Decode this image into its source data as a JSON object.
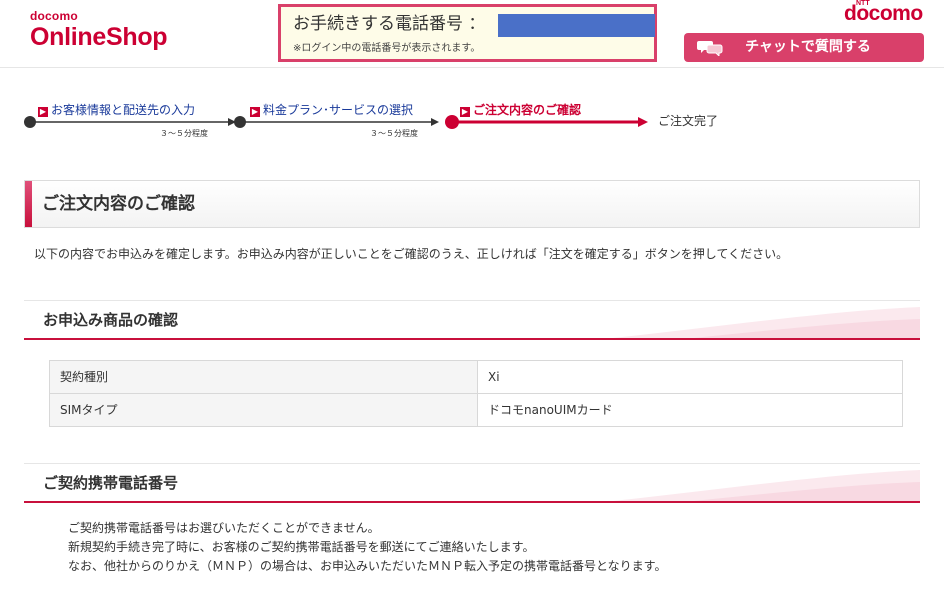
{
  "header": {
    "logo_small": "docomo",
    "logo_big": "OnlineShop",
    "phone_label": "お手続きする電話番号 ：",
    "phone_note": "※ログイン中の電話番号が表示されます。",
    "brand_ntt": "NTT",
    "brand_name": "docomo",
    "chat_button": "チャットで質問する",
    "chat_icon": "chat-bubbles-icon"
  },
  "steps": [
    {
      "label": "お客様情報と配送先の入力",
      "time": "３〜５分程度",
      "state": "done"
    },
    {
      "label": "料金プラン･サービスの選択",
      "time": "３〜５分程度",
      "state": "done"
    },
    {
      "label": "ご注文内容のご確認",
      "state": "active"
    },
    {
      "label": "ご注文完了",
      "state": "pending"
    }
  ],
  "page_title": "ご注文内容のご確認",
  "intro": "以下の内容でお申込みを確定します。お申込み内容が正しいことをご確認のうえ、正しければ「注文を確定する」ボタンを押してください。",
  "product_section": {
    "title": "お申込み商品の確認",
    "rows": [
      {
        "key": "契約種別",
        "value": "Xi"
      },
      {
        "key": "SIMタイプ",
        "value": "ドコモnanoUIMカード"
      }
    ]
  },
  "number_section": {
    "title": "ご契約携帯電話番号",
    "lines": [
      "ご契約携帯電話番号はお選びいただくことができません。",
      "新規契約手続き完了時に、お客様のご契約携帯電話番号を郵送にてご連絡いたします。",
      "なお、他社からのりかえ（ＭＮＰ）の場合は、お申込みいただいたＭＮＰ転入予定の携帯電話番号となります。"
    ]
  },
  "colors": {
    "accent": "#cc0033",
    "accent_pink": "#d9406a",
    "step_link": "#1a3a9a",
    "phone_box_bg": "#fefce8",
    "phone_value": "#4a70c8"
  }
}
